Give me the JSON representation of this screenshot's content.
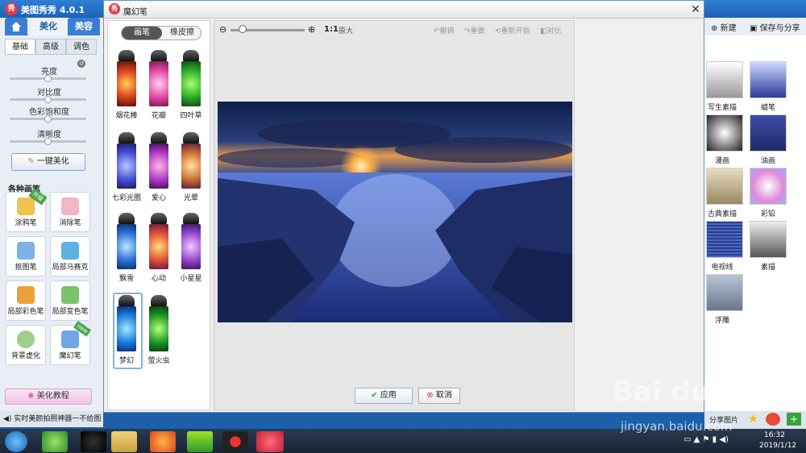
{
  "app": {
    "title": "美图秀秀 4.0.1",
    "logo_text": "秀"
  },
  "main_tabs": [
    {
      "label": "美化"
    },
    {
      "label": "美容"
    }
  ],
  "sub_tabs": [
    {
      "label": "基础"
    },
    {
      "label": "高级"
    },
    {
      "label": "调色"
    }
  ],
  "adjustments": [
    {
      "label": "亮度",
      "value": 0.5
    },
    {
      "label": "对比度",
      "value": 0.5
    },
    {
      "label": "色彩饱和度",
      "value": 0.5
    },
    {
      "label": "清晰度",
      "value": 0.5
    }
  ],
  "one_click_label": "一键美化",
  "brush_section_title": "各种画笔",
  "brushes": [
    {
      "label": "涂鸦笔",
      "badge": "升级"
    },
    {
      "label": "消除笔"
    },
    {
      "label": "抠图笔"
    },
    {
      "label": "局部马赛克"
    },
    {
      "label": "局部彩色笔"
    },
    {
      "label": "局部变色笔"
    },
    {
      "label": "背景虚化"
    },
    {
      "label": "魔幻笔",
      "badge": "new"
    }
  ],
  "tutorial_label": "美化教程",
  "status_text": "实时美颜拍照神器一不给图",
  "dialog": {
    "title": "魔幻笔",
    "logo_text": "秀",
    "close": "✕",
    "mode_brush": "画笔",
    "mode_eraser": "橡皮擦",
    "pens": [
      {
        "label": "烟花棒"
      },
      {
        "label": "花瓣"
      },
      {
        "label": "四叶草"
      },
      {
        "label": "七彩光圈"
      },
      {
        "label": "爱心"
      },
      {
        "label": "光晕"
      },
      {
        "label": "飘雪"
      },
      {
        "label": "心动"
      },
      {
        "label": "小星星"
      },
      {
        "label": "梦幻"
      },
      {
        "label": "萤火虫"
      }
    ],
    "zoom_ratio": "1:1",
    "zoom_label": "原大",
    "actions": [
      "撤销",
      "重做",
      "重新开始",
      "对比"
    ],
    "apply_label": "应用",
    "cancel_label": "取消"
  },
  "right_panel": {
    "new_label": "新建",
    "save_label": "保存与分享",
    "effects": [
      {
        "label": "写生素描"
      },
      {
        "label": "蜡笔"
      },
      {
        "label": "漫画"
      },
      {
        "label": "油画"
      },
      {
        "label": "古典素描"
      },
      {
        "label": "彩铅"
      },
      {
        "label": "电视线"
      },
      {
        "label": "素描"
      },
      {
        "label": "浮雕"
      }
    ],
    "share_label": "分享图片"
  },
  "taskbar": {
    "time": "16:32",
    "date": "2019/1/12"
  },
  "watermark": {
    "brand": "Bai du 经验",
    "url": "jingyan.baidu.com"
  }
}
